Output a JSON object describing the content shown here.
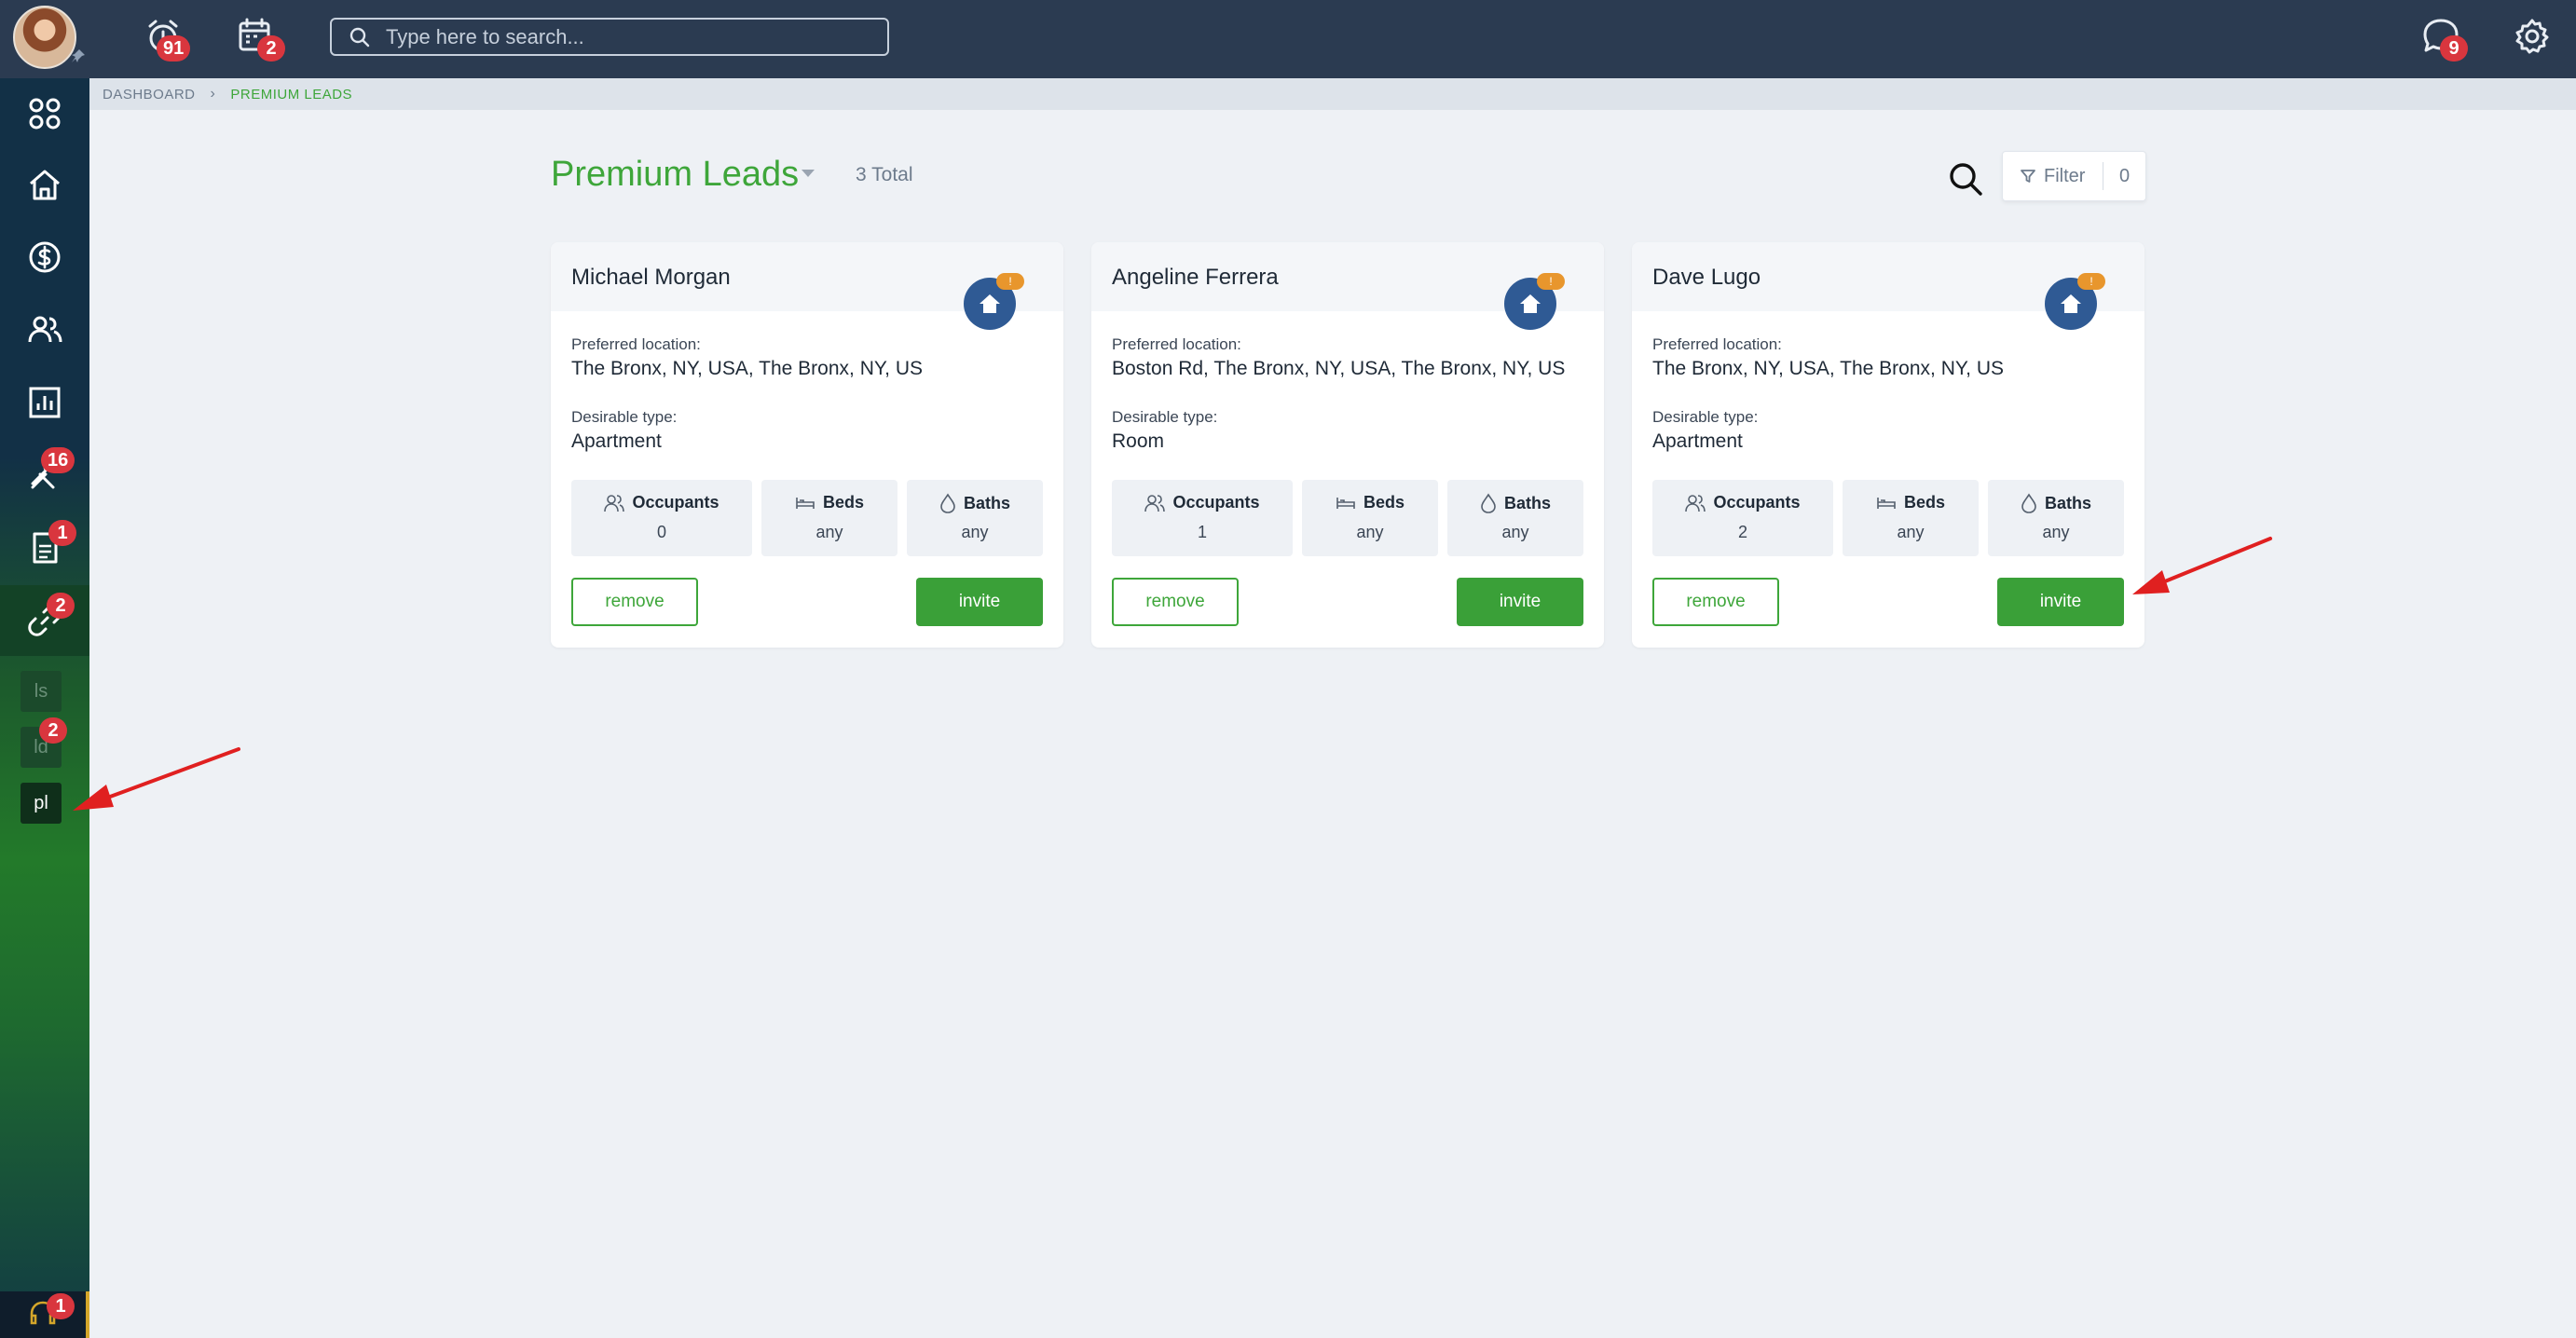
{
  "topbar": {
    "alarm_badge": "91",
    "calendar_badge": "2",
    "search_placeholder": "Type here to search...",
    "messages_badge": "9"
  },
  "sidebar": {
    "maintenance_badge": "16",
    "documents_badge": "1",
    "leads_badge": "2",
    "sub_items": [
      {
        "label": "ls",
        "badge": ""
      },
      {
        "label": "ld",
        "badge": "2"
      },
      {
        "label": "pl",
        "badge": ""
      }
    ],
    "support_badge": "1"
  },
  "breadcrumb": {
    "items": [
      "DASHBOARD",
      "PREMIUM LEADS"
    ]
  },
  "page": {
    "title": "Premium Leads",
    "total": "3 Total",
    "filter_label": "Filter",
    "filter_count": "0"
  },
  "labels": {
    "preferred_location": "Preferred location:",
    "desirable_type": "Desirable type:",
    "occupants": "Occupants",
    "beds": "Beds",
    "baths": "Baths",
    "remove": "remove",
    "invite": "invite",
    "house_badge": "!"
  },
  "leads": [
    {
      "name": "Michael Morgan",
      "location": "The Bronx, NY, USA, The Bronx, NY, US",
      "type": "Apartment",
      "occupants": "0",
      "beds": "any",
      "baths": "any"
    },
    {
      "name": "Angeline Ferrera",
      "location": "Boston Rd, The Bronx, NY, USA, The Bronx, NY, US",
      "type": "Room",
      "occupants": "1",
      "beds": "any",
      "baths": "any"
    },
    {
      "name": "Dave Lugo",
      "location": "The Bronx, NY, USA, The Bronx, NY, US",
      "type": "Apartment",
      "occupants": "2",
      "beds": "any",
      "baths": "any"
    }
  ],
  "colors": {
    "accent_green": "#3ea63a",
    "topbar": "#2b3b51",
    "badge_red": "#d9363e",
    "house_blue": "#2f5a94"
  }
}
